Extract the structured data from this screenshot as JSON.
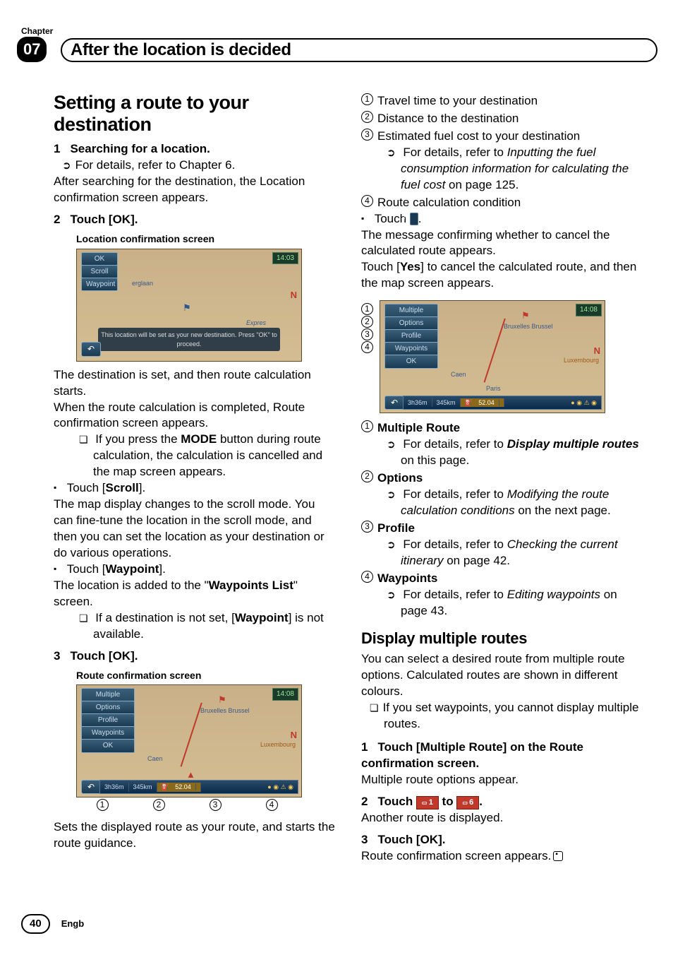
{
  "chapter": {
    "label": "Chapter",
    "number": "07",
    "title": "After the location is decided"
  },
  "left": {
    "h1": "Setting a route to your destination",
    "s1_title": "Searching for a location.",
    "s1_ref": "For details, refer to Chapter 6.",
    "s1_after": "After searching for the destination, the Location confirmation screen appears.",
    "s2_title": "Touch [OK].",
    "caption1": "Location confirmation screen",
    "ss1": {
      "ok": "OK",
      "scroll": "Scroll",
      "waypoint": "Waypoint",
      "time": "14:03",
      "msg": "This location will be set as your new destination. Press \"OK\" to proceed.",
      "compass": "N",
      "expr": "Expres",
      "erg": "erglaan"
    },
    "p_dest_set": "The destination is set, and then route calculation starts.",
    "p_route_done": "When the route calculation is completed, Route confirmation screen appears.",
    "note_mode": "If you press the ",
    "note_mode_b": "MODE",
    "note_mode2": " button during route calculation, the calculation is cancelled and the map screen appears.",
    "touch_scroll": "Touch [",
    "touch_scroll_b": "Scroll",
    "touch_scroll2": "].",
    "p_scroll": "The map display changes to the scroll mode. You can fine-tune the location in the scroll mode, and then you can set the location as your destination or do various operations.",
    "touch_wp": "Touch [",
    "touch_wp_b": "Waypoint",
    "touch_wp2": "].",
    "p_wp": "The location is added to the \"",
    "p_wp_b": "Waypoints List",
    "p_wp2": "\" screen.",
    "note_wp": "If a destination is not set, [",
    "note_wp_b": "Waypoint",
    "note_wp2": "] is not available.",
    "s3_title": "Touch [OK].",
    "caption2": "Route confirmation screen",
    "ss2": {
      "mult": "Multiple Route",
      "opt": "Options",
      "prof": "Profile",
      "wp": "Waypoints",
      "ok": "OK",
      "time": "14:08",
      "t1": "3h36m",
      "t2": "345km",
      "t3": "52.04",
      "city1": "Bruxelles Brussel",
      "city2": "Luxembourg",
      "city3": "Caen",
      "compass": "N"
    },
    "p_sets": "Sets the displayed route as your route, and starts the route guidance."
  },
  "right": {
    "n1": "Travel time to your destination",
    "n2": "Distance to the destination",
    "n3": "Estimated fuel cost to your destination",
    "n3_ref1": "For details, refer to ",
    "n3_ref_i": "Inputting the fuel consumption information for calculating the fuel cost",
    "n3_ref2": " on page 125.",
    "n4": "Route calculation condition",
    "touch_back": "Touch ",
    "touch_back2": ".",
    "p_cancel": "The message confirming whether to cancel the calculated route appears.",
    "p_yes1": "Touch [",
    "p_yes_b": "Yes",
    "p_yes2": "] to cancel the calculated route, and then the map screen appears.",
    "ss3": {
      "mult": "Multiple Route",
      "opt": "Options",
      "prof": "Profile",
      "wp": "Waypoints",
      "ok": "OK",
      "time": "14:08",
      "t1": "3h36m",
      "t2": "345km",
      "t3": "52.04",
      "city1": "Bruxelles Brussel",
      "city2": "Luxembourg",
      "city3": "Caen",
      "city4": "Paris",
      "compass": "N"
    },
    "m1_b": "Multiple Route",
    "m1_ref1": "For details, refer to ",
    "m1_ref_b": "Display multiple routes",
    "m1_ref2": " on this page.",
    "m2_b": "Options",
    "m2_ref1": "For details, refer to ",
    "m2_ref_i": "Modifying the route calculation conditions",
    "m2_ref2": " on the next page.",
    "m3_b": "Profile",
    "m3_ref1": "For details, refer to ",
    "m3_ref_i": "Checking the current itinerary",
    "m3_ref2": " on page 42.",
    "m4_b": "Waypoints",
    "m4_ref1": "For details, refer to ",
    "m4_ref_i": "Editing waypoints",
    "m4_ref2": " on page 43.",
    "h2": "Display multiple routes",
    "dmr_p": "You can select a desired route from multiple route options. Calculated routes are shown in different colours.",
    "dmr_note": "If you set waypoints, you cannot display multiple routes.",
    "dmr_s1": "Touch [Multiple Route] on the Route confirmation screen.",
    "dmr_s1_p": "Multiple route options appear.",
    "dmr_s2a": "Touch ",
    "dmr_s2_1": "1",
    "dmr_s2b": " to ",
    "dmr_s2_6": "6",
    "dmr_s2c": ".",
    "dmr_s2_p": "Another route is displayed.",
    "dmr_s3": "Touch [OK].",
    "dmr_s3_p": "Route confirmation screen appears."
  },
  "footer": {
    "page": "40",
    "lang": "Engb"
  },
  "circ": {
    "c1": "1",
    "c2": "2",
    "c3": "3",
    "c4": "4"
  }
}
